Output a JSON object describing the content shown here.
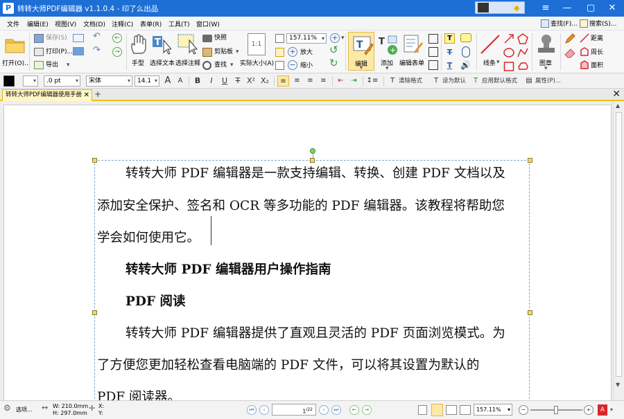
{
  "titlebar": {
    "app_title": "转转大师PDF编辑器 v1.1.0.4 - 印了么出品",
    "logo_letter": "P"
  },
  "menu": {
    "items": [
      "文件",
      "编辑(E)",
      "视图(V)",
      "文档(D)",
      "注释(C)",
      "表单(R)",
      "工具(T)",
      "窗口(W)"
    ],
    "find_label": "查找(F)...",
    "search_label": "搜索(S)..."
  },
  "ribbon": {
    "open": "打开(O)...",
    "save": "保存(S)",
    "print": "打印(P)...",
    "export": "导出",
    "hand": "手型",
    "select_text": "选择文本",
    "select_annot": "选择注释",
    "snapshot": "快照",
    "clipboard": "剪贴板",
    "find": "查找",
    "actual_size": "实际大小(A)",
    "zoom_value": "157.11%",
    "zoom_in": "放大",
    "zoom_out": "缩小",
    "edit": "编辑",
    "add": "添加",
    "edit_form": "编辑表单",
    "line": "线条",
    "stamp": "图章",
    "distance": "距离",
    "perimeter": "周长",
    "area": "面积"
  },
  "format": {
    "color": "#000000",
    "line_width": ".0 pt",
    "font_name": "宋体",
    "font_size": "14.1",
    "clear_format": "清除格式",
    "set_default": "设为默认",
    "apply_default": "应用默认格式",
    "properties": "属性(P)..."
  },
  "tabs": {
    "doc_title": "转转大师PDF编辑器使用手册"
  },
  "document": {
    "p1_line1": "转转大师 PDF 编辑器是一款支持编辑、转换、创建 PDF 文档以及",
    "p1_line2": "添加安全保护、签名和 OCR 等多功能的 PDF 编辑器。该教程将帮助您",
    "p1_line3": "学会如何使用它。",
    "heading1": "转转大师 PDF 编辑器用户操作指南",
    "heading2": "PDF 阅读",
    "p2_line1": "转转大师 PDF 编辑器提供了直观且灵活的 PDF 页面浏览模式。为",
    "p2_line2": "了方便您更加轻松查看电脑端的 PDF 文件，可以将其设置为默认的",
    "p2_line3": "PDF 阅读器。"
  },
  "status": {
    "options": "选项...",
    "width": "W: 210.0mm",
    "height": "H: 297.0mm",
    "x": "X:",
    "y": "Y:",
    "current_page": "1",
    "total_pages": "/22",
    "zoom": "157.11%"
  },
  "icons": [
    "open-folder-icon",
    "save-icon",
    "print-icon",
    "export-icon",
    "mail-icon",
    "undo-icon",
    "redo-icon",
    "hand-icon",
    "select-text-icon",
    "select-annotation-icon",
    "camera-icon",
    "clipboard-icon",
    "search-icon",
    "actual-size-icon",
    "zoom-in-icon",
    "zoom-out-icon",
    "edit-text-icon",
    "add-icon",
    "edit-form-icon",
    "line-icon",
    "arrow-icon",
    "ellipse-icon",
    "rectangle-icon",
    "stamp-icon",
    "pencil-icon",
    "eraser-icon",
    "distance-icon",
    "perimeter-icon",
    "area-icon",
    "settings-icon",
    "pdf-icon"
  ],
  "accent": {
    "title_bg": "#1d6fd6",
    "tab_border": "#f2c200"
  }
}
